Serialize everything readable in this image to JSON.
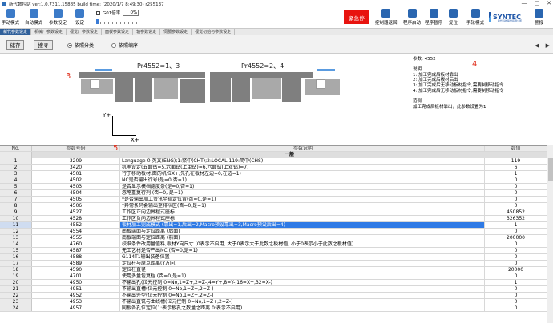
{
  "window": {
    "title": "新代数控站 ver:1.0.7311.15885 build time: (2020/1/7 8:49:30) r255137",
    "controls": [
      "—",
      "□",
      "✕"
    ]
  },
  "toolbar": {
    "items": [
      {
        "label": "手动模式",
        "icon": "hand-mode-icon",
        "color": "#3c7bc8"
      },
      {
        "label": "自动模式",
        "icon": "auto-mode-icon",
        "color": "#3c7bc8"
      },
      {
        "label": "参数设定",
        "icon": "param-settings-icon",
        "color": "#3c7bc8"
      },
      {
        "label": "设定",
        "icon": "settings-icon",
        "color": "#3c7bc8"
      }
    ],
    "g01_label": "G01倍率",
    "g01_value": "0%",
    "g01_slider_fraction": 0,
    "estop_label": "紧急停",
    "right_items": [
      {
        "label": "控制器返回",
        "icon": "controller-return-icon",
        "color": "#2a66b0"
      },
      {
        "label": "程序启动",
        "icon": "program-start-icon",
        "color": "#2a66b0"
      },
      {
        "label": "程序暂停",
        "icon": "program-pause-icon",
        "color": "#2a66b0"
      },
      {
        "label": "复位",
        "icon": "reset-icon",
        "color": "#2a66b0"
      },
      {
        "label": "手轮模式",
        "icon": "handwheel-mode-icon",
        "color": "#2a66b0"
      },
      {
        "label": "警报",
        "icon": "alarm-icon",
        "color": "#2a66b0"
      }
    ],
    "logo_text": "SYNTEC",
    "logo_sub": "新代科技股份有限公司"
  },
  "tabs": [
    "新代参数设定",
    "机械厂参数设定",
    "视觉厂参数设定",
    "面板参数设定",
    "轴参数设定",
    "伺服参数设定",
    "视觉初始与参数设定"
  ],
  "actions": {
    "save_label": "储存",
    "search_label": "搜寻",
    "radio_1": "依照分类",
    "radio_2": "依照编序",
    "selected_radio": 1
  },
  "diagram": {
    "num_3": "3",
    "left_label": "Pr4552=1、3",
    "right_label": "Pr4552=2、4",
    "y_axis": "Y+",
    "x_axis": "X+"
  },
  "info": {
    "num_4": "4",
    "param_title": "参数: 4552",
    "desc_heading": "说明",
    "desc_lines": [
      "1: 加工完成后板材靠出",
      "2: 加工完成后板材后出",
      "3: 加工完成后无移动板材指令,需要制移动指令",
      "4: 加工完成后无移动板材指令,需要制移动指令"
    ],
    "example_heading": "范例",
    "example_line": "加工完成后板材靠出，此参数设置为1"
  },
  "table": {
    "num_5": "5",
    "headers": {
      "no": "No.",
      "code": "参数号码",
      "desc": "参数说明",
      "value": "数值"
    },
    "group_label": "一般",
    "rows": [
      {
        "no": "1",
        "code": "3209",
        "desc": "Language-0:英文(ENG);1:繁中(CHT);2:LOCAL;119:简中(CHS)",
        "value": "119"
      },
      {
        "no": "2",
        "code": "3420",
        "desc": "机率设定(五面钻=5,六面钻(上单钻)=6,六面钻(上双钻)=7)",
        "value": "6"
      },
      {
        "no": "3",
        "code": "4501",
        "desc": "行于移动板材,面的机位X+,先孔在板材左边=0,在边=1)",
        "value": "1"
      },
      {
        "no": "4",
        "code": "4502",
        "desc": "NC是否输出行号(是=0,否=1)",
        "value": "0"
      },
      {
        "no": "5",
        "code": "4503",
        "desc": "是否显示模档德度条(是=0,否=1)",
        "value": "0"
      },
      {
        "no": "6",
        "code": "4504",
        "desc": "忽略重复行列 (否=0, 是=1)",
        "value": "0"
      },
      {
        "no": "7",
        "code": "4505",
        "desc": "*是否输出加工资讯至指定位置(否=0,是=1)",
        "value": "0"
      },
      {
        "no": "8",
        "code": "4506",
        "desc": "*异常条码会输出至排队区(否=0,是=1)",
        "value": "0"
      },
      {
        "no": "9",
        "code": "4527",
        "desc": "工作区正向边界程式座标",
        "value": "450852"
      },
      {
        "no": "10",
        "code": "4528",
        "desc": "工作区负向边界程式座标",
        "value": "326352"
      },
      {
        "no": "11",
        "code": "4552",
        "desc": "板材加工完成模式 (靠出=1,后出=2,Macro预设靠出=3,Macro预设后出=4)",
        "value": "1"
      },
      {
        "no": "12",
        "code": "4554",
        "desc": "南板端面与定位距离 (后面)",
        "value": "0"
      },
      {
        "no": "13",
        "code": "4555",
        "desc": "南板端面与定位距离 (前面)",
        "value": "200000"
      },
      {
        "no": "14",
        "code": "4760",
        "desc": "校准条件改用量值料,板材Y向尺寸 (0表示不启用, 大于0表示大于此数之板材值, 小于0表示小于此数之板材值)",
        "value": "0"
      },
      {
        "no": "15",
        "code": "4587",
        "desc": "无工艺材是否产出NC (否=0,是=1)",
        "value": "0"
      },
      {
        "no": "16",
        "code": "4588",
        "desc": "G114T1输出装备位置",
        "value": "0"
      },
      {
        "no": "17",
        "code": "4589",
        "desc": "定位柱与原点距离(Y方向)",
        "value": "0"
      },
      {
        "no": "18",
        "code": "4590",
        "desc": "定位柱直径",
        "value": "20000"
      },
      {
        "no": "19",
        "code": "4701",
        "desc": "使用多量包复程 (否=0,是=1)",
        "value": "0"
      },
      {
        "no": "20",
        "code": "4950",
        "desc": "不输出孔(位元控制 0=No,1=Z+,2=Z-,4=Y+,8=Y-,16=X+,32=X-)",
        "value": "1"
      },
      {
        "no": "21",
        "code": "4951",
        "desc": "不输出直槽(位元控制 0=No,1=Z+,2=Z-)",
        "value": "0"
      },
      {
        "no": "22",
        "code": "4952",
        "desc": "不输出外型(位元控制 0=No,1=Z+,2=Z-)",
        "value": "0"
      },
      {
        "no": "23",
        "code": "4953",
        "desc": "不输出直铣与曲线槽(位元控制 0=No,1=Z+,2=Z-)",
        "value": "0"
      },
      {
        "no": "24",
        "code": "4957",
        "desc": "同板各孔位定位(1:表示板孔之数量之距离 0:表示不启用)",
        "value": "0"
      }
    ],
    "selected_row": 10
  }
}
